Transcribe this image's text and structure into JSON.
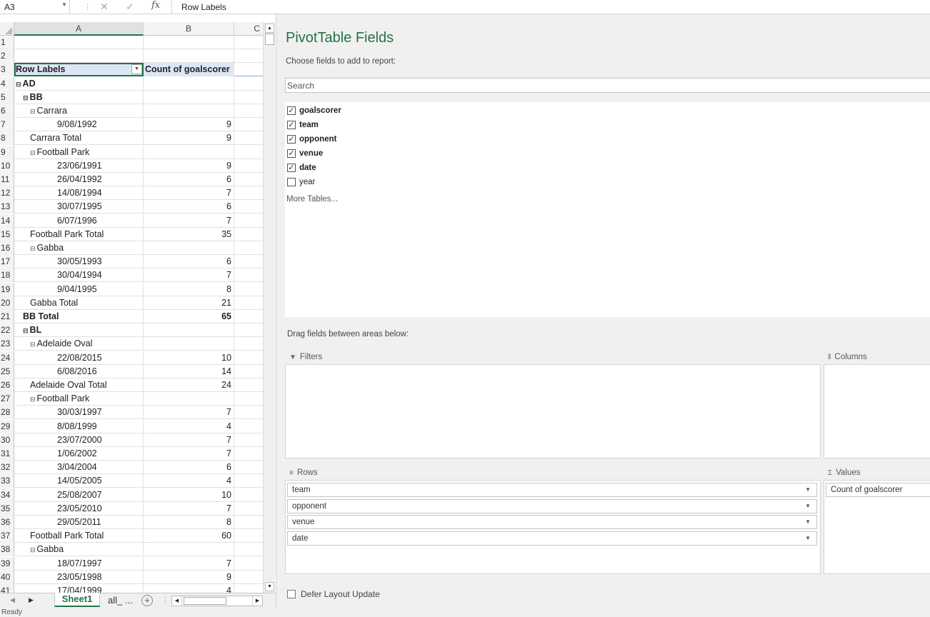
{
  "formula_bar": {
    "name_box": "A3",
    "formula": "Row Labels",
    "fx_label": "fx",
    "cancel_icon": "✕",
    "enter_icon": "✓"
  },
  "columns": [
    "A",
    "B",
    "C"
  ],
  "grid_rows": [
    {
      "n": "1",
      "a": "",
      "b": "",
      "style": "plain",
      "indent": 0
    },
    {
      "n": "2",
      "a": "",
      "b": "",
      "style": "plain",
      "indent": 0
    },
    {
      "n": "3",
      "a": "Row Labels",
      "b": "Count of goalscorer",
      "style": "header",
      "indent": 0
    },
    {
      "n": "4",
      "a": "AD",
      "b": "",
      "style": "bold",
      "indent": 0,
      "exp": true
    },
    {
      "n": "5",
      "a": "BB",
      "b": "",
      "style": "bold",
      "indent": 1,
      "exp": true
    },
    {
      "n": "6",
      "a": "Carrara",
      "b": "",
      "style": "plain",
      "indent": 2,
      "exp": true
    },
    {
      "n": "7",
      "a": "9/08/1992",
      "b": "9",
      "style": "plain",
      "indent": 4
    },
    {
      "n": "8",
      "a": "Carrara Total",
      "b": "9",
      "style": "plain",
      "indent": 2
    },
    {
      "n": "9",
      "a": "Football Park",
      "b": "",
      "style": "plain",
      "indent": 2,
      "exp": true
    },
    {
      "n": "10",
      "a": "23/06/1991",
      "b": "9",
      "style": "plain",
      "indent": 4
    },
    {
      "n": "11",
      "a": "26/04/1992",
      "b": "6",
      "style": "plain",
      "indent": 4
    },
    {
      "n": "12",
      "a": "14/08/1994",
      "b": "7",
      "style": "plain",
      "indent": 4
    },
    {
      "n": "13",
      "a": "30/07/1995",
      "b": "6",
      "style": "plain",
      "indent": 4
    },
    {
      "n": "14",
      "a": "6/07/1996",
      "b": "7",
      "style": "plain",
      "indent": 4
    },
    {
      "n": "15",
      "a": "Football Park Total",
      "b": "35",
      "style": "plain",
      "indent": 2
    },
    {
      "n": "16",
      "a": "Gabba",
      "b": "",
      "style": "plain",
      "indent": 2,
      "exp": true
    },
    {
      "n": "17",
      "a": "30/05/1993",
      "b": "6",
      "style": "plain",
      "indent": 4
    },
    {
      "n": "18",
      "a": "30/04/1994",
      "b": "7",
      "style": "plain",
      "indent": 4
    },
    {
      "n": "19",
      "a": "9/04/1995",
      "b": "8",
      "style": "plain",
      "indent": 4
    },
    {
      "n": "20",
      "a": "Gabba Total",
      "b": "21",
      "style": "plain",
      "indent": 2
    },
    {
      "n": "21",
      "a": "BB Total",
      "b": "65",
      "style": "bold",
      "indent": 1
    },
    {
      "n": "22",
      "a": "BL",
      "b": "",
      "style": "bold",
      "indent": 1,
      "exp": true
    },
    {
      "n": "23",
      "a": "Adelaide Oval",
      "b": "",
      "style": "plain",
      "indent": 2,
      "exp": true
    },
    {
      "n": "24",
      "a": "22/08/2015",
      "b": "10",
      "style": "plain",
      "indent": 4
    },
    {
      "n": "25",
      "a": "6/08/2016",
      "b": "14",
      "style": "plain",
      "indent": 4
    },
    {
      "n": "26",
      "a": "Adelaide Oval Total",
      "b": "24",
      "style": "plain",
      "indent": 2
    },
    {
      "n": "27",
      "a": "Football Park",
      "b": "",
      "style": "plain",
      "indent": 2,
      "exp": true
    },
    {
      "n": "28",
      "a": "30/03/1997",
      "b": "7",
      "style": "plain",
      "indent": 4
    },
    {
      "n": "29",
      "a": "8/08/1999",
      "b": "4",
      "style": "plain",
      "indent": 4
    },
    {
      "n": "30",
      "a": "23/07/2000",
      "b": "7",
      "style": "plain",
      "indent": 4
    },
    {
      "n": "31",
      "a": "1/06/2002",
      "b": "7",
      "style": "plain",
      "indent": 4
    },
    {
      "n": "32",
      "a": "3/04/2004",
      "b": "6",
      "style": "plain",
      "indent": 4
    },
    {
      "n": "33",
      "a": "14/05/2005",
      "b": "4",
      "style": "plain",
      "indent": 4
    },
    {
      "n": "34",
      "a": "25/08/2007",
      "b": "10",
      "style": "plain",
      "indent": 4
    },
    {
      "n": "35",
      "a": "23/05/2010",
      "b": "7",
      "style": "plain",
      "indent": 4
    },
    {
      "n": "36",
      "a": "29/05/2011",
      "b": "8",
      "style": "plain",
      "indent": 4
    },
    {
      "n": "37",
      "a": "Football Park Total",
      "b": "60",
      "style": "plain",
      "indent": 2
    },
    {
      "n": "38",
      "a": "Gabba",
      "b": "",
      "style": "plain",
      "indent": 2,
      "exp": true
    },
    {
      "n": "39",
      "a": "18/07/1997",
      "b": "7",
      "style": "plain",
      "indent": 4
    },
    {
      "n": "40",
      "a": "23/05/1998",
      "b": "9",
      "style": "plain",
      "indent": 4
    },
    {
      "n": "41",
      "a": "17/04/1999",
      "b": "4",
      "style": "plain",
      "indent": 4
    }
  ],
  "sheet_tabs": {
    "active": "Sheet1",
    "other": "all_ ...",
    "add_label": "+"
  },
  "status": "Ready",
  "pivot": {
    "title": "PivotTable Fields",
    "subtitle": "Choose fields to add to report:",
    "search_placeholder": "Search",
    "fields": [
      {
        "label": "goalscorer",
        "checked": true
      },
      {
        "label": "team",
        "checked": true
      },
      {
        "label": "opponent",
        "checked": true
      },
      {
        "label": "venue",
        "checked": true
      },
      {
        "label": "date",
        "checked": true
      },
      {
        "label": "year",
        "checked": false
      }
    ],
    "more_tables": "More Tables...",
    "drag_label": "Drag fields between areas below:",
    "areas": {
      "filters": {
        "label": "Filters",
        "items": []
      },
      "columns": {
        "label": "Columns",
        "items": []
      },
      "rows": {
        "label": "Rows",
        "items": [
          "team",
          "opponent",
          "venue",
          "date"
        ]
      },
      "values": {
        "label": "Values",
        "items": [
          "Count of goalscorer"
        ]
      }
    },
    "defer_label": "Defer Layout Update"
  }
}
